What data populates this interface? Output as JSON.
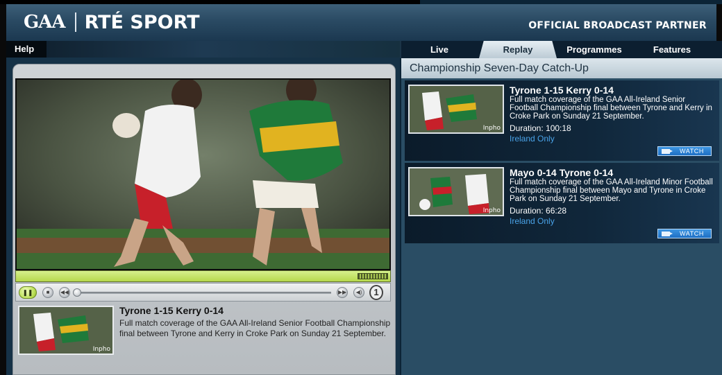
{
  "header": {
    "logo_gaa": "GAA",
    "logo_rte": "RTÉ SPORT",
    "partner": "OFFICIAL BROADCAST PARTNER"
  },
  "help": {
    "label": "Help"
  },
  "nav": {
    "tabs": [
      {
        "label": "Live"
      },
      {
        "label": "Replay",
        "active": true
      },
      {
        "label": "Programmes"
      },
      {
        "label": "Features"
      }
    ]
  },
  "section_title": "Championship Seven-Day Catch-Up",
  "player": {
    "now_playing": {
      "title": "Tyrone 1-15 Kerry 0-14",
      "description": "Full match coverage of the GAA All-Ireland Senior Football Championship final between Tyrone and Kerry in Croke Park on Sunday 21 September.",
      "credit": "Inpho"
    },
    "channel": "1",
    "progress_fraction": 0.0
  },
  "items": [
    {
      "title": "Tyrone 1-15 Kerry 0-14",
      "description": "Full match coverage of the GAA All-Ireland Senior Football Championship final between Tyrone and Kerry in Croke Park on Sunday 21 September.",
      "duration": "Duration: 100:18",
      "region": "Ireland Only",
      "watch": "WATCH",
      "credit": "Inpho"
    },
    {
      "title": "Mayo 0-14 Tyrone 0-14",
      "description": "Full match coverage of the GAA All-Ireland Minor Football Championship final between Mayo and Tyrone in Croke Park on Sunday 21 September.",
      "duration": "Duration: 66:28",
      "region": "Ireland Only",
      "watch": "WATCH",
      "credit": "Inpho"
    }
  ],
  "colors": {
    "accent_blue": "#1e6fc4",
    "region_blue": "#4aa3e8",
    "progress_green": "#b6d84c"
  },
  "icons": {
    "pause": "pause-icon",
    "stop": "stop-icon",
    "rewind": "rewind-icon",
    "forward": "forward-icon",
    "volume": "volume-icon",
    "camera": "camera-icon"
  }
}
